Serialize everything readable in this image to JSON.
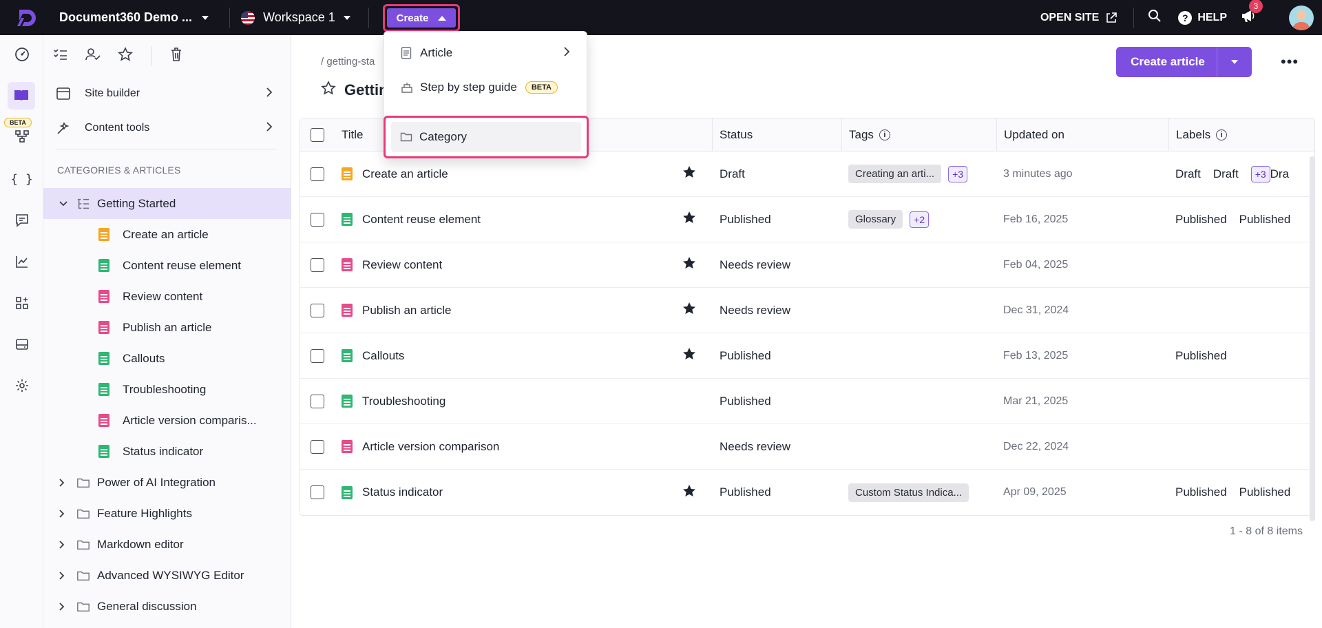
{
  "topbar": {
    "project_name": "Document360 Demo ...",
    "workspace": "Workspace 1",
    "create_label": "Create",
    "open_site": "OPEN SITE",
    "help": "HELP",
    "notification_count": "3"
  },
  "rail": {
    "beta_badge": "BETA"
  },
  "sidebar": {
    "menu": [
      {
        "label": "Site builder",
        "icon": "site-builder-icon"
      },
      {
        "label": "Content tools",
        "icon": "content-tools-icon"
      }
    ],
    "section_title": "CATEGORIES & ARTICLES",
    "tree": {
      "expanded": "Getting Started",
      "children": [
        {
          "label": "Create an article",
          "status": "draft"
        },
        {
          "label": "Content reuse element",
          "status": "published"
        },
        {
          "label": "Review content",
          "status": "review"
        },
        {
          "label": "Publish an article",
          "status": "review"
        },
        {
          "label": "Callouts",
          "status": "published"
        },
        {
          "label": "Troubleshooting",
          "status": "published"
        },
        {
          "label": "Article version comparis...",
          "status": "review"
        },
        {
          "label": "Status indicator",
          "status": "published"
        }
      ],
      "folders": [
        "Power of AI Integration",
        "Feature Highlights",
        "Markdown editor",
        "Advanced WYSIWYG Editor",
        "General discussion"
      ]
    }
  },
  "main": {
    "breadcrumb": "/ getting-sta",
    "title": "Gettin",
    "create_article": "Create article",
    "columns": {
      "title": "Title",
      "status": "Status",
      "tags": "Tags",
      "updated": "Updated on",
      "labels": "Labels"
    },
    "rows": [
      {
        "title": "Create an article",
        "status_type": "draft",
        "starred": true,
        "status": "Draft",
        "tags": [
          "Creating an arti..."
        ],
        "more_tags": "+3",
        "updated": "3 minutes ago",
        "labels": [
          "Draft",
          "Draft"
        ],
        "more_labels": "+3",
        "label_tail": "Dra"
      },
      {
        "title": "Content reuse element",
        "status_type": "published",
        "starred": true,
        "status": "Published",
        "tags": [
          "Glossary"
        ],
        "more_tags": "+2",
        "updated": "Feb 16, 2025",
        "labels": [
          "Published",
          "Published"
        ],
        "more_labels": "",
        "label_tail": ""
      },
      {
        "title": "Review content",
        "status_type": "review",
        "starred": true,
        "status": "Needs review",
        "tags": [],
        "more_tags": "",
        "updated": "Feb 04, 2025",
        "labels": [],
        "more_labels": "",
        "label_tail": ""
      },
      {
        "title": "Publish an article",
        "status_type": "review",
        "starred": true,
        "status": "Needs review",
        "tags": [],
        "more_tags": "",
        "updated": "Dec 31, 2024",
        "labels": [],
        "more_labels": "",
        "label_tail": ""
      },
      {
        "title": "Callouts",
        "status_type": "published",
        "starred": true,
        "status": "Published",
        "tags": [],
        "more_tags": "",
        "updated": "Feb 13, 2025",
        "labels": [
          "Published"
        ],
        "more_labels": "",
        "label_tail": ""
      },
      {
        "title": "Troubleshooting",
        "status_type": "published",
        "starred": false,
        "status": "Published",
        "tags": [],
        "more_tags": "",
        "updated": "Mar 21, 2025",
        "labels": [],
        "more_labels": "",
        "label_tail": ""
      },
      {
        "title": "Article version comparison",
        "status_type": "review",
        "starred": false,
        "status": "Needs review",
        "tags": [],
        "more_tags": "",
        "updated": "Dec 22, 2024",
        "labels": [],
        "more_labels": "",
        "label_tail": ""
      },
      {
        "title": "Status indicator",
        "status_type": "published",
        "starred": true,
        "status": "Published",
        "tags": [
          "Custom Status Indica..."
        ],
        "more_tags": "",
        "updated": "Apr 09, 2025",
        "labels": [
          "Published",
          "Published"
        ],
        "more_labels": "",
        "label_tail": ""
      }
    ],
    "pager": "1 - 8 of 8 items"
  },
  "create_menu": {
    "items": [
      {
        "label": "Article",
        "icon": "article-icon"
      },
      {
        "label": "Step by step guide",
        "icon": "guide-icon",
        "badge": "BETA"
      }
    ],
    "category": "Category"
  },
  "colors": {
    "accent": "#7c4fe0",
    "highlight": "#e83a7a",
    "draft": "#f5a623",
    "published": "#2eb872",
    "review": "#e84a8a"
  }
}
